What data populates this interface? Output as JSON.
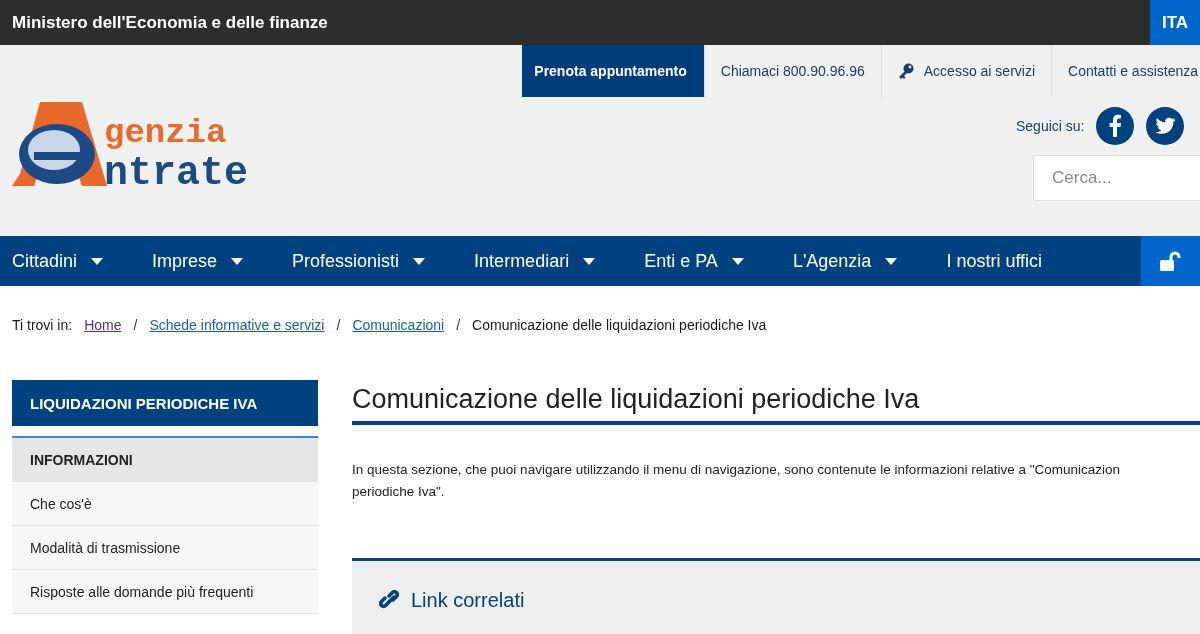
{
  "top_bar": {
    "title": "Ministero dell'Economia e delle finanze",
    "language": "ITA"
  },
  "utility_nav": [
    {
      "label": "Prenota appuntamento",
      "kind": "primary"
    },
    {
      "label": "Chiamaci 800.90.96.96",
      "kind": "plain"
    },
    {
      "label": "Accesso ai servizi",
      "kind": "key"
    },
    {
      "label": "Contatti e assistenza",
      "kind": "plain"
    }
  ],
  "logo": {
    "line_1": "genzia",
    "line_2": "ntrate"
  },
  "social": {
    "label": "Seguici su:"
  },
  "search": {
    "placeholder": "Cerca..."
  },
  "main_nav": [
    {
      "label": "Cittadini",
      "dropdown": true
    },
    {
      "label": "Imprese",
      "dropdown": true
    },
    {
      "label": "Professionisti",
      "dropdown": true
    },
    {
      "label": "Intermediari",
      "dropdown": true
    },
    {
      "label": "Enti e PA",
      "dropdown": true
    },
    {
      "label": "L'Agenzia",
      "dropdown": true
    },
    {
      "label": "I nostri uffici",
      "dropdown": false
    }
  ],
  "breadcrumb": {
    "label": "Ti trovi in:",
    "separator": "/",
    "items": [
      {
        "label": "Home",
        "kind": "link"
      },
      {
        "label": "Schede informative e servizi",
        "kind": "link"
      },
      {
        "label": "Comunicazioni",
        "kind": "link"
      },
      {
        "label": "Comunicazione delle liquidazioni periodiche Iva",
        "kind": "current"
      }
    ]
  },
  "sidebar": {
    "title": "LIQUIDAZIONI PERIODICHE IVA",
    "items": [
      {
        "label": "INFORMAZIONI",
        "selected": true
      },
      {
        "label": "Che cos'è",
        "selected": false
      },
      {
        "label": "Modalità di trasmissione",
        "selected": false
      },
      {
        "label": "Risposte alle domande più frequenti",
        "selected": false
      }
    ]
  },
  "content": {
    "title": "Comunicazione delle liquidazioni periodiche Iva",
    "paragraph_lines": [
      "In questa sezione, che puoi navigare utilizzando il menu di navigazione, sono contenute le informazioni relative a \"Comunicazion",
      "periodiche Iva\"."
    ],
    "related_title": "Link correlati"
  }
}
